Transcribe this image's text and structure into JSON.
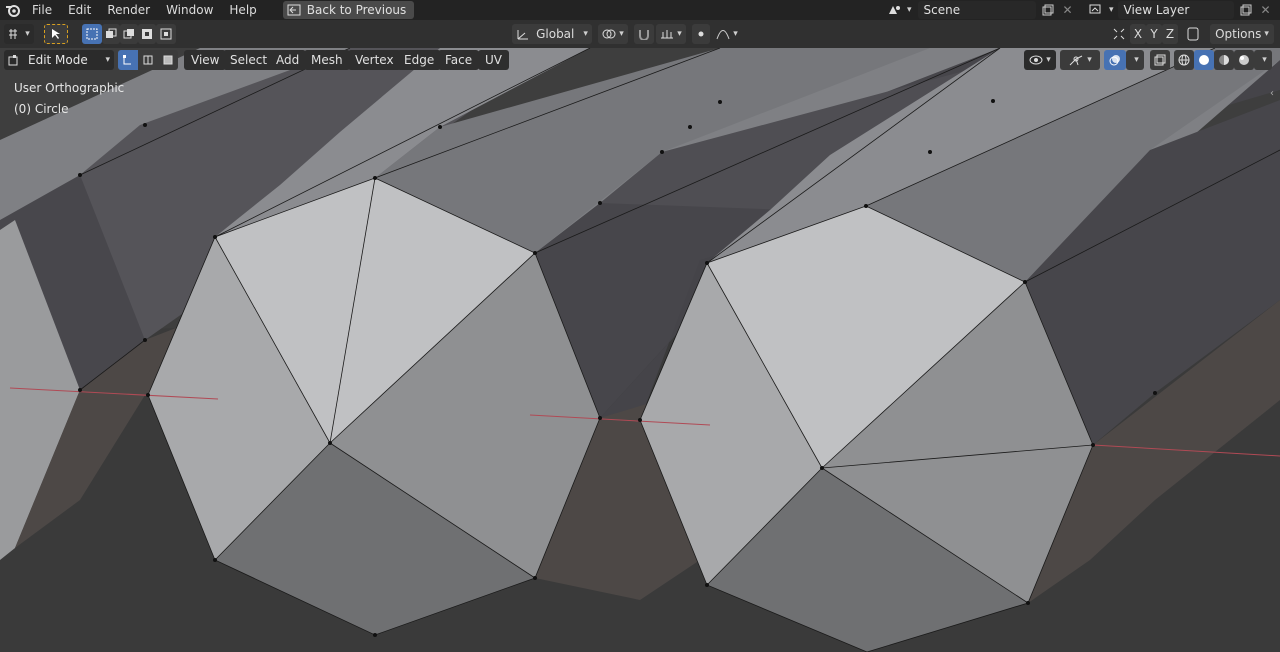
{
  "menubar": {
    "items": [
      "File",
      "Edit",
      "Render",
      "Window",
      "Help"
    ],
    "back_label": "Back to Previous",
    "scene": "Scene",
    "view_layer": "View Layer"
  },
  "header": {
    "orientation": "Global",
    "axes": [
      "X",
      "Y",
      "Z"
    ],
    "options_label": "Options"
  },
  "edit_header": {
    "mode": "Edit Mode",
    "menus": [
      "View",
      "Select",
      "Add",
      "Mesh",
      "Vertex",
      "Edge",
      "Face",
      "UV"
    ]
  },
  "viewport": {
    "view_name": "User Orthographic",
    "object_name": "(0) Circle"
  },
  "colors": {
    "accent": "#4772b3",
    "bg": "#3d3d3d",
    "topbar": "#232323"
  }
}
